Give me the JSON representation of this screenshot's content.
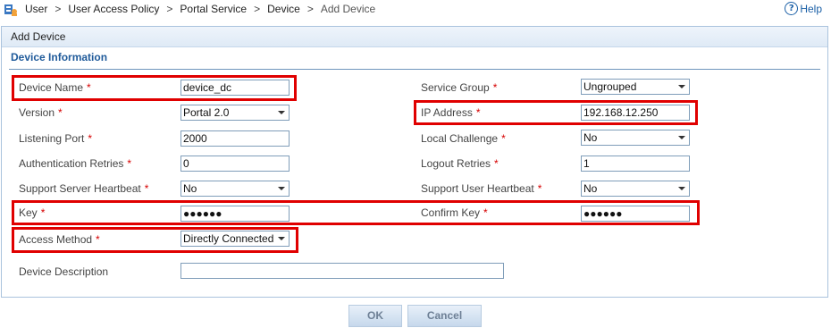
{
  "breadcrumb": {
    "items": [
      "User",
      "User Access Policy",
      "Portal Service",
      "Device",
      "Add Device"
    ],
    "separator": ">"
  },
  "help": {
    "label": "Help"
  },
  "panel": {
    "title": "Add Device",
    "section_title": "Device Information"
  },
  "form": {
    "left": {
      "device_name": {
        "label": "Device Name",
        "value": "device_dc"
      },
      "version": {
        "label": "Version",
        "value": "Portal 2.0"
      },
      "listening_port": {
        "label": "Listening Port",
        "value": "2000"
      },
      "authentication_retries": {
        "label": "Authentication Retries",
        "value": "0"
      },
      "support_server_heartbeat": {
        "label": "Support Server Heartbeat",
        "value": "No"
      },
      "key": {
        "label": "Key",
        "value": "●●●●●●"
      },
      "access_method": {
        "label": "Access Method",
        "value": "Directly Connected"
      },
      "device_description": {
        "label": "Device Description",
        "value": ""
      }
    },
    "right": {
      "service_group": {
        "label": "Service Group",
        "value": "Ungrouped"
      },
      "ip_address": {
        "label": "IP Address",
        "value": "192.168.12.250"
      },
      "local_challenge": {
        "label": "Local Challenge",
        "value": "No"
      },
      "logout_retries": {
        "label": "Logout Retries",
        "value": "1"
      },
      "support_user_heartbeat": {
        "label": "Support User Heartbeat",
        "value": "No"
      },
      "confirm_key": {
        "label": "Confirm Key",
        "value": "●●●●●●"
      }
    },
    "required_marker": "*"
  },
  "buttons": {
    "ok": "OK",
    "cancel": "Cancel"
  },
  "colors": {
    "highlight": "#e00000",
    "required": "#d60000",
    "section_title": "#1f5a9a"
  }
}
